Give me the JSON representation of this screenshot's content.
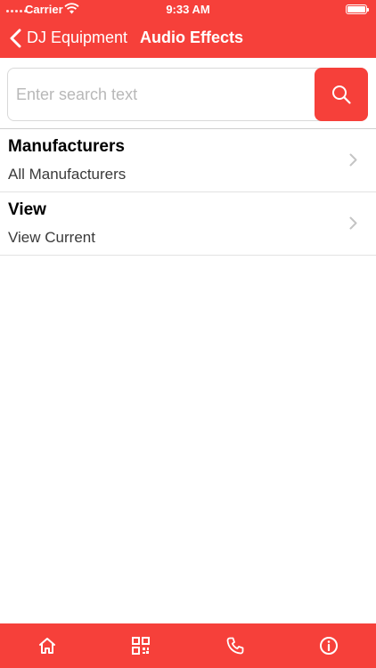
{
  "status_bar": {
    "carrier": "Carrier",
    "time": "9:33 AM"
  },
  "nav": {
    "back_label": "DJ Equipment",
    "title": "Audio Effects"
  },
  "search": {
    "placeholder": "Enter search text",
    "value": ""
  },
  "rows": [
    {
      "title": "Manufacturers",
      "subtitle": "All Manufacturers"
    },
    {
      "title": "View",
      "subtitle": "View Current"
    }
  ],
  "tabs": [
    {
      "icon": "home-icon"
    },
    {
      "icon": "qr-grid-icon"
    },
    {
      "icon": "phone-icon"
    },
    {
      "icon": "info-icon"
    }
  ],
  "colors": {
    "accent": "#f6403a",
    "text": "#000000",
    "placeholder": "#b8b8b8"
  }
}
